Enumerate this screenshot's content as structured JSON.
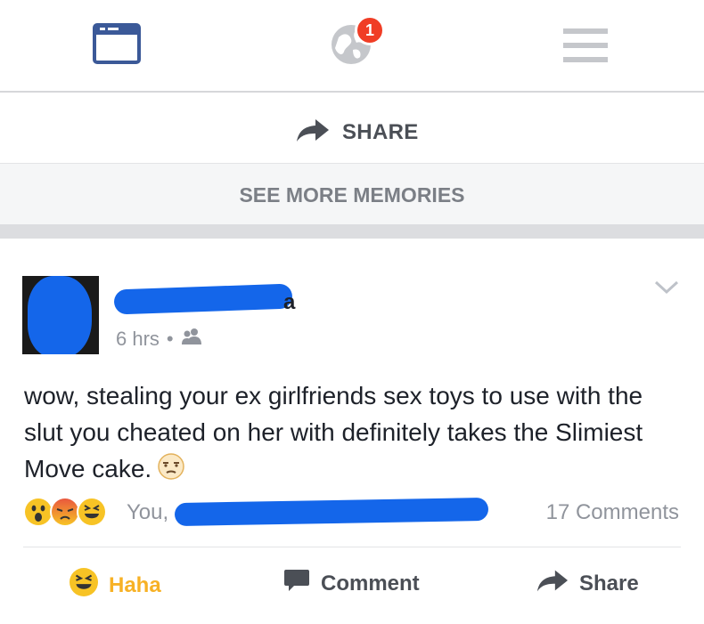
{
  "nav": {
    "notification_count": "1",
    "icons": [
      "news-feed-icon",
      "globe-icon",
      "menu-icon"
    ]
  },
  "memories": {
    "share_label": "SHARE",
    "see_more_label": "SEE MORE MEMORIES"
  },
  "post": {
    "author_visible_fragment": "a",
    "timestamp": "6 hrs",
    "audience": "friends-icon",
    "text": "wow, stealing your ex girlfriends sex toys to use with the slut you cheated on her with definitely takes the Slimiest Move cake.",
    "reactions_prefix": "You,",
    "comments_count": "17 Comments"
  },
  "actions": {
    "haha_label": "Haha",
    "comment_label": "Comment",
    "share_label": "Share"
  },
  "colors": {
    "accent": "#3b5998",
    "redaction": "#1466ea",
    "badge": "#f03d25",
    "haha": "#f7b125"
  }
}
